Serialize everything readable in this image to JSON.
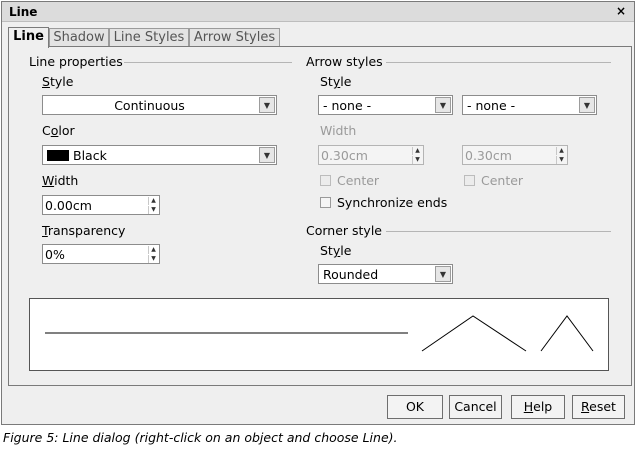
{
  "window": {
    "title": "Line",
    "close_glyph": "×"
  },
  "tabs": [
    {
      "label": "Line",
      "active": true
    },
    {
      "label": "Shadow",
      "active": false
    },
    {
      "label": "Line Styles",
      "active": false
    },
    {
      "label": "Arrow Styles",
      "active": false
    }
  ],
  "line_properties": {
    "title": "Line properties",
    "style_label": "Style",
    "style_value": "Continuous",
    "color_label": "Color",
    "color_value": "Black",
    "color_hex": "#000000",
    "width_label": "Width",
    "width_value": "0.00cm",
    "transparency_label": "Transparency",
    "transparency_value": "0%"
  },
  "arrow_styles": {
    "title": "Arrow styles",
    "style_label": "Style",
    "start_style": "- none -",
    "end_style": "- none -",
    "width_label": "Width",
    "start_width": "0.30cm",
    "end_width": "0.30cm",
    "center_label": "Center",
    "synchronize_label": "Synchronize ends"
  },
  "corner_style": {
    "title": "Corner style",
    "style_label": "Style",
    "style_value": "Rounded"
  },
  "buttons": {
    "ok": "OK",
    "cancel": "Cancel",
    "help": "Help",
    "reset": "Reset"
  },
  "caption": "Figure 5: Line dialog (right-click on an object and choose Line)."
}
